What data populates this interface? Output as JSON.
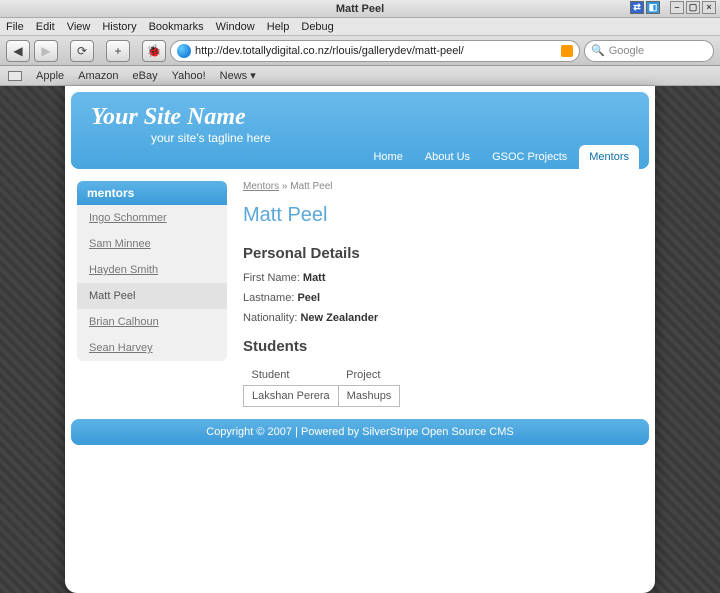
{
  "window": {
    "title": "Matt Peel"
  },
  "menubar": [
    "File",
    "Edit",
    "View",
    "History",
    "Bookmarks",
    "Window",
    "Help",
    "Debug"
  ],
  "toolbar": {
    "url": "http://dev.totallydigital.co.nz/rlouis/gallerydev/matt-peel/",
    "search_placeholder": "Google",
    "search_provider": "Q"
  },
  "bookmarks": [
    "Apple",
    "Amazon",
    "eBay",
    "Yahoo!",
    "News ▾"
  ],
  "site": {
    "title": "Your Site Name",
    "tagline": "your site's tagline here",
    "nav": [
      {
        "label": "Home",
        "active": false
      },
      {
        "label": "About Us",
        "active": false
      },
      {
        "label": "GSOC Projects",
        "active": false
      },
      {
        "label": "Mentors",
        "active": true
      }
    ]
  },
  "sidebar": {
    "header": "mentors",
    "items": [
      {
        "label": "Ingo Schommer",
        "active": false
      },
      {
        "label": "Sam Minnee",
        "active": false
      },
      {
        "label": "Hayden Smith",
        "active": false
      },
      {
        "label": "Matt Peel",
        "active": true
      },
      {
        "label": "Brian Calhoun",
        "active": false
      },
      {
        "label": "Sean Harvey",
        "active": false
      }
    ]
  },
  "breadcrumb": {
    "link": "Mentors",
    "sep": "»",
    "current": "Matt Peel"
  },
  "page": {
    "title": "Matt Peel",
    "section1": "Personal Details",
    "details": {
      "firstname_label": "First Name:",
      "firstname_value": "Matt",
      "lastname_label": "Lastname:",
      "lastname_value": "Peel",
      "nationality_label": "Nationality:",
      "nationality_value": "New Zealander"
    },
    "section2": "Students",
    "table": {
      "col1": "Student",
      "col2": "Project",
      "row1c1": "Lakshan Perera",
      "row1c2": "Mashups"
    }
  },
  "footer": "Copyright © 2007 | Powered by SilverStripe Open Source CMS"
}
